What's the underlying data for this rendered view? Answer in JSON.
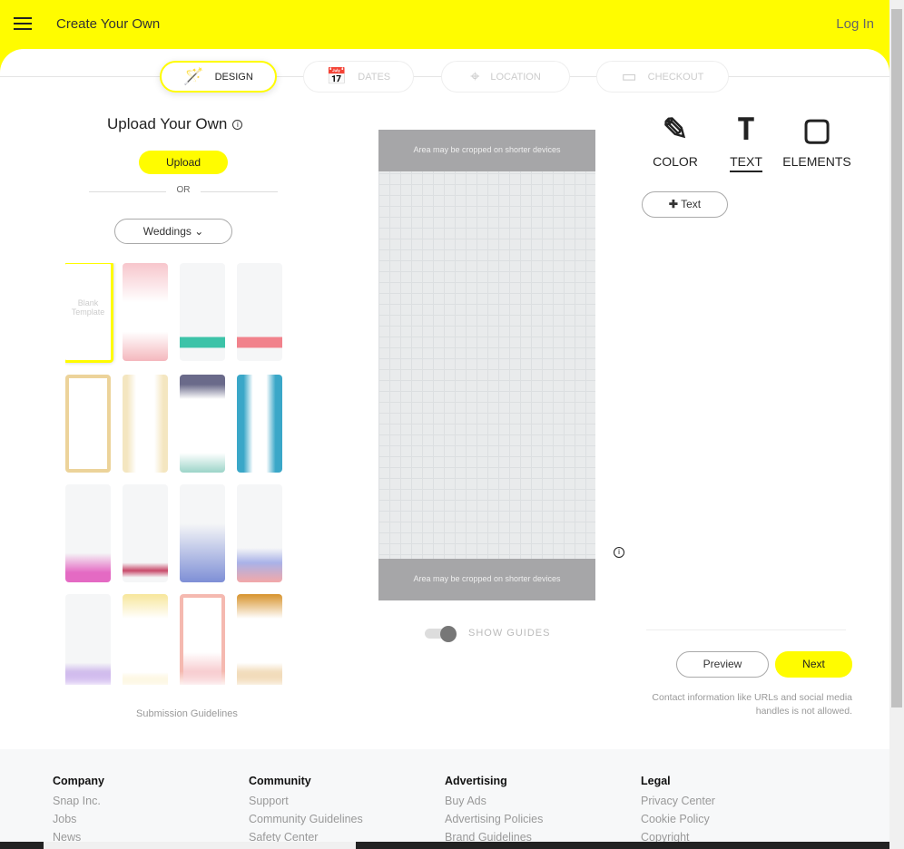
{
  "header": {
    "title": "Create Your Own",
    "login": "Log In"
  },
  "steps": [
    {
      "label": "DESIGN",
      "icon": "magic-wand-icon",
      "active": true
    },
    {
      "label": "DATES",
      "icon": "calendar-icon"
    },
    {
      "label": "LOCATION",
      "icon": "map-pin-icon"
    },
    {
      "label": "CHECKOUT",
      "icon": "card-icon"
    }
  ],
  "left": {
    "title": "Upload Your Own",
    "upload": "Upload",
    "or": "OR",
    "category": "Weddings",
    "blank": "Blank Template",
    "guidelines": "Submission Guidelines"
  },
  "canvas": {
    "crop_top": "Area may be cropped on shorter devices",
    "crop_bottom": "Area may be cropped on shorter devices",
    "show_guides": "SHOW GUIDES",
    "guides_on": true
  },
  "tabs": [
    {
      "label": "COLOR",
      "icon": "pencil-icon"
    },
    {
      "label": "TEXT",
      "icon": "text-icon",
      "active": true
    },
    {
      "label": "ELEMENTS",
      "icon": "sticker-icon"
    }
  ],
  "right": {
    "add_text": "Text",
    "preview": "Preview",
    "next": "Next",
    "note": "Contact information like URLs and social media handles is not allowed."
  },
  "footer": [
    {
      "heading": "Company",
      "links": [
        "Snap Inc.",
        "Jobs",
        "News"
      ]
    },
    {
      "heading": "Community",
      "links": [
        "Support",
        "Community Guidelines",
        "Safety Center"
      ]
    },
    {
      "heading": "Advertising",
      "links": [
        "Buy Ads",
        "Advertising Policies",
        "Brand Guidelines"
      ]
    },
    {
      "heading": "Legal",
      "links": [
        "Privacy Center",
        "Cookie Policy",
        "Copyright"
      ]
    }
  ]
}
